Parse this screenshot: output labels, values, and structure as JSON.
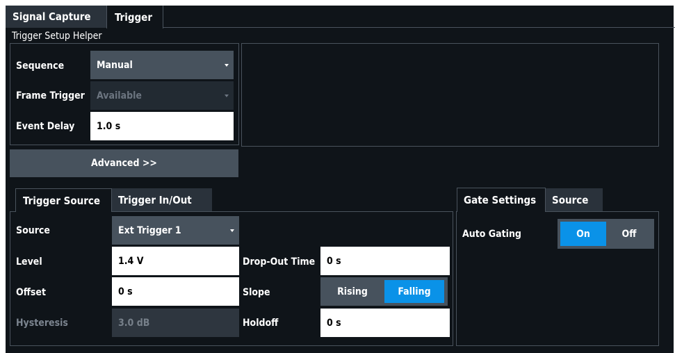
{
  "tabs": [
    "Signal Capture",
    "Trigger"
  ],
  "helper": {
    "title": "Trigger Setup Helper",
    "sequence_label": "Sequence",
    "sequence_value": "Manual",
    "frame_trigger_label": "Frame Trigger",
    "frame_trigger_value": "Available",
    "event_delay_label": "Event Delay",
    "event_delay_value": "1.0 s",
    "advanced_label": "Advanced >>"
  },
  "trigger": {
    "tabs": [
      "Trigger Source",
      "Trigger In/Out"
    ],
    "source_label": "Source",
    "source_value": "Ext Trigger 1",
    "level_label": "Level",
    "level_value": "1.4 V",
    "offset_label": "Offset",
    "offset_value": "0 s",
    "hysteresis_label": "Hysteresis",
    "hysteresis_value": "3.0 dB",
    "dropout_label": "Drop-Out Time",
    "dropout_value": "0 s",
    "slope_label": "Slope",
    "slope_options": [
      "Rising",
      "Falling"
    ],
    "slope_selected": "Falling",
    "holdoff_label": "Holdoff",
    "holdoff_value": "0 s"
  },
  "gate": {
    "tabs": [
      "Gate Settings",
      "Source"
    ],
    "auto_gating_label": "Auto Gating",
    "options": [
      "On",
      "Off"
    ],
    "selected": "On"
  },
  "colors": {
    "panel_bg": "#0f1419",
    "accent": "#0a92e8",
    "control_bg": "#47525d",
    "border": "#4a535d"
  }
}
